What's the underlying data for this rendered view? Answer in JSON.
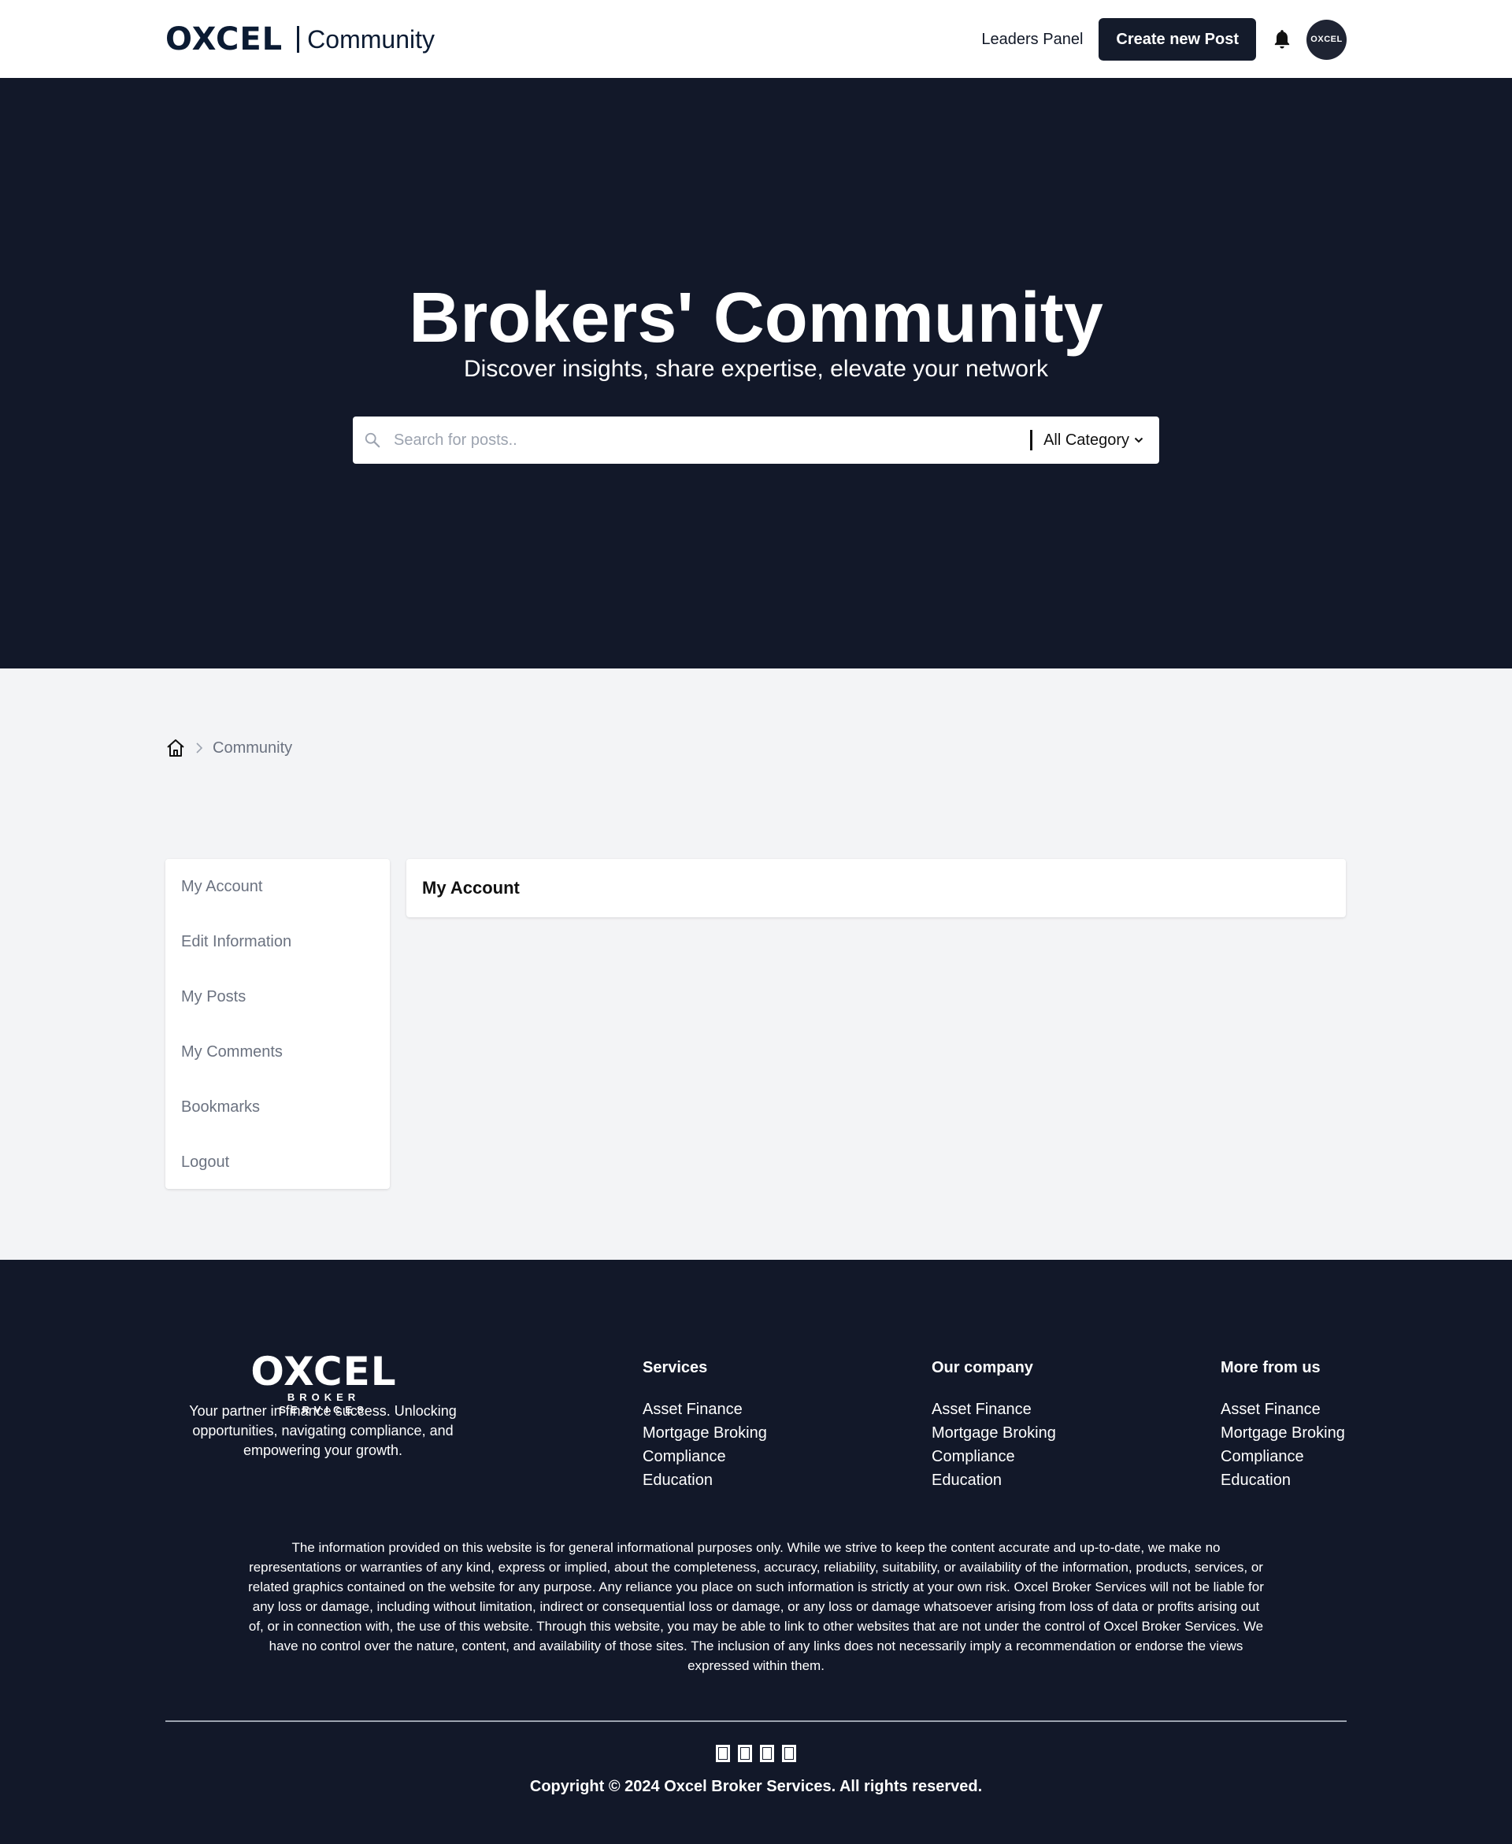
{
  "header": {
    "logo_text": "OXCEL",
    "brand_sub": "Community",
    "leaders_label": "Leaders Panel",
    "create_label": "Create new Post",
    "avatar_text": "OXCEL"
  },
  "hero": {
    "title": "Brokers' Community",
    "subtitle": "Discover insights, share expertise, elevate your network",
    "search_placeholder": "Search for posts..",
    "category_label": "All Category"
  },
  "breadcrumb": {
    "current": "Community"
  },
  "sidebar": {
    "items": [
      {
        "label": "My Account"
      },
      {
        "label": "Edit Information"
      },
      {
        "label": "My Posts"
      },
      {
        "label": "My Comments"
      },
      {
        "label": "Bookmarks"
      },
      {
        "label": "Logout"
      }
    ]
  },
  "panel": {
    "title": "My Account"
  },
  "footer": {
    "logo_text": "OXCEL",
    "logo_sub": "BROKER SERVICES",
    "tagline": "Your partner in finance success. Unlocking opportunities, navigating compliance, and empowering your growth.",
    "columns": [
      {
        "title": "Services",
        "links": [
          "Asset Finance",
          "Mortgage Broking",
          "Compliance",
          "Education"
        ]
      },
      {
        "title": "Our company",
        "links": [
          "Asset Finance",
          "Mortgage Broking",
          "Compliance",
          "Education"
        ]
      },
      {
        "title": "More from us",
        "links": [
          "Asset Finance",
          "Mortgage Broking",
          "Compliance",
          "Education"
        ]
      }
    ],
    "disclaimer": "The information provided on this website is for general informational purposes only. While we strive to keep the content accurate and up-to-date, we make no representations or warranties of any kind, express or implied, about the completeness, accuracy, reliability, suitability, or availability of the information, products, services, or related graphics contained on the website for any purpose. Any reliance you place on such information is strictly at your own risk. Oxcel Broker Services will not be liable for any loss or damage, including without limitation, indirect or consequential loss or damage, or any loss or damage whatsoever arising from loss of data or profits arising out of, or in connection with, the use of this website. Through this website, you may be able to link to other websites that are not under the control of Oxcel Broker Services. We have no control over the nature, content, and availability of those sites. The inclusion of any links does not necessarily imply a recommendation or endorse the views expressed within them.",
    "social_icons": [
      "social-icon-1",
      "social-icon-2",
      "social-icon-3",
      "social-icon-4"
    ],
    "copyright": "Copyright © 2024 Oxcel Broker Services. All rights reserved."
  },
  "colors": {
    "dark": "#121829",
    "button": "#141b2b",
    "page_bg": "#f3f4f6",
    "muted_text": "#6b7280"
  }
}
